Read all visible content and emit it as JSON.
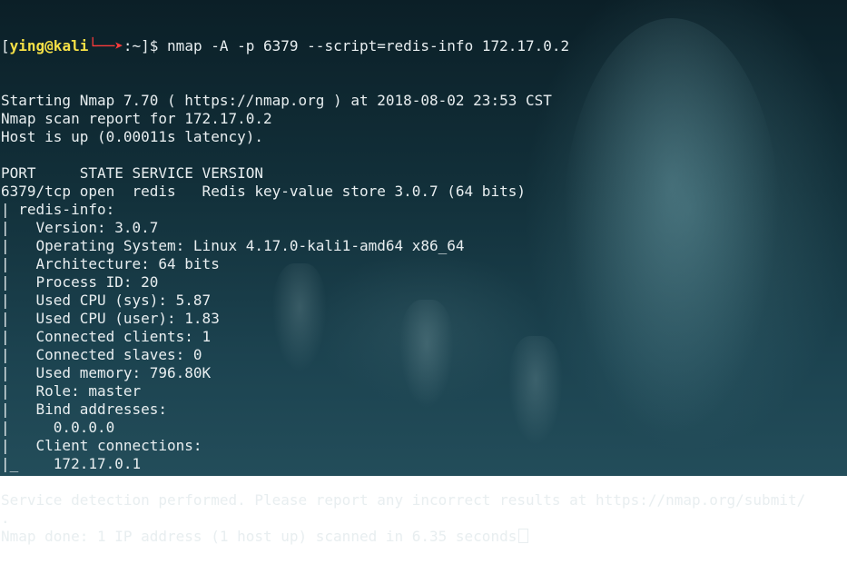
{
  "prompt": {
    "open_bracket": "[",
    "user": "ying@kali",
    "arrow": "└──➤",
    "path": ":~]$ ",
    "command": "nmap -A -p 6379 --script=redis-info 172.17.0.2"
  },
  "output_lines": [
    "Starting Nmap 7.70 ( https://nmap.org ) at 2018-08-02 23:53 CST",
    "Nmap scan report for 172.17.0.2",
    "Host is up (0.00011s latency).",
    "",
    "PORT     STATE SERVICE VERSION",
    "6379/tcp open  redis   Redis key-value store 3.0.7 (64 bits)",
    "| redis-info:",
    "|   Version: 3.0.7",
    "|   Operating System: Linux 4.17.0-kali1-amd64 x86_64",
    "|   Architecture: 64 bits",
    "|   Process ID: 20",
    "|   Used CPU (sys): 5.87",
    "|   Used CPU (user): 1.83",
    "|   Connected clients: 1",
    "|   Connected slaves: 0",
    "|   Used memory: 796.80K",
    "|   Role: master",
    "|   Bind addresses:",
    "|     0.0.0.0",
    "|   Client connections:",
    "|_    172.17.0.1",
    "",
    "Service detection performed. Please report any incorrect results at https://nmap.org/submit/",
    ".",
    "Nmap done: 1 IP address (1 host up) scanned in 6.35 seconds"
  ],
  "colors": {
    "user": "#f5e046",
    "arrow": "#ff3b3b",
    "text": "#e8eef0",
    "background": "#12303a"
  }
}
